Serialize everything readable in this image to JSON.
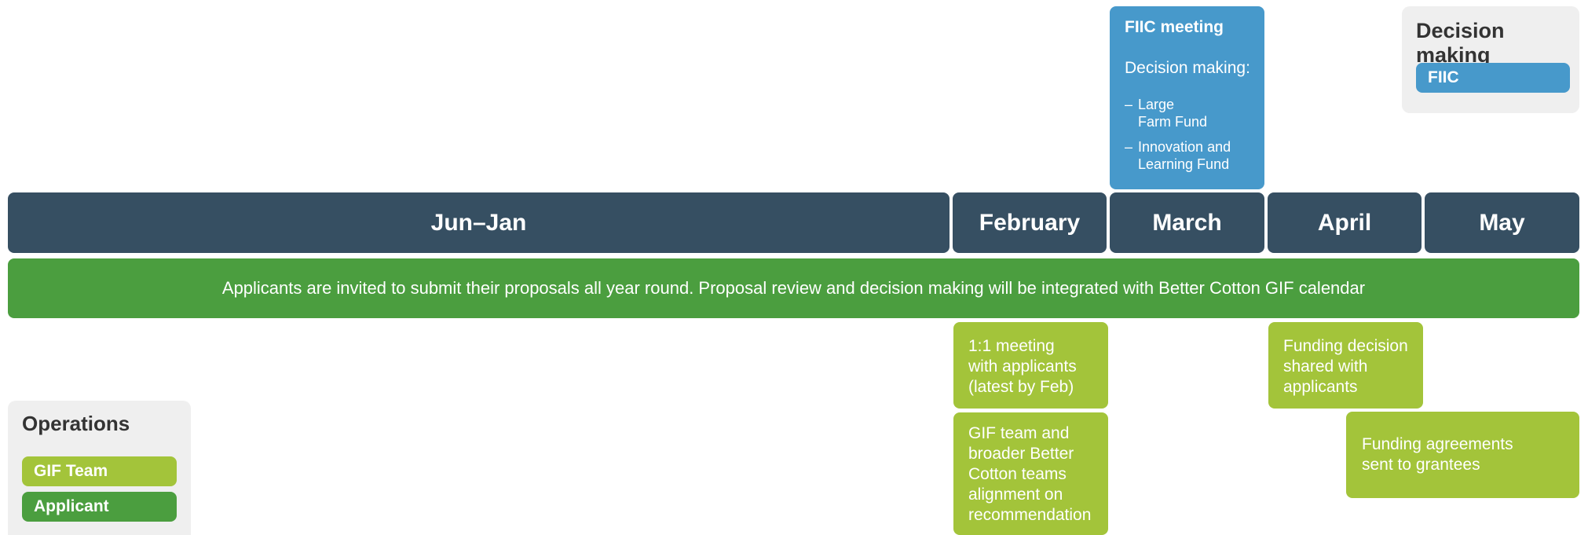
{
  "months": [
    "Jun–Jan",
    "February",
    "March",
    "April",
    "May"
  ],
  "band_text": "Applicants are invited to submit their proposals all year round. Proposal review and decision making will be integrated with Better Cotton GIF calendar",
  "fiic_meeting": {
    "title": "FIIC meeting",
    "subtitle": "Decision making:",
    "items": [
      {
        "dash": "–",
        "text": "Large\nFarm Fund"
      },
      {
        "dash": "–",
        "text": "Innovation and\nLearning Fund"
      }
    ]
  },
  "decision_legend": {
    "title": "Decision making",
    "items": [
      {
        "label": "FIIC",
        "color": "#4799cb"
      }
    ]
  },
  "operations_legend": {
    "title": "Operations",
    "items": [
      {
        "label": "GIF Team",
        "color": "#a3c43a"
      },
      {
        "label": "Applicant",
        "color": "#4b9e3f"
      }
    ]
  },
  "activities": [
    "1:1 meeting\nwith applicants\n(latest by Feb)",
    "GIF team and\nbroader Better\nCotton teams\nalignment on\nrecommendation",
    "Funding decision\nshared with\napplicants",
    "Funding agreements\nsent to grantees"
  ],
  "colors": {
    "month_header": "#364f62",
    "applicant_band": "#4b9e3f",
    "gif_team": "#a3c43a",
    "fiic": "#4799cb"
  }
}
